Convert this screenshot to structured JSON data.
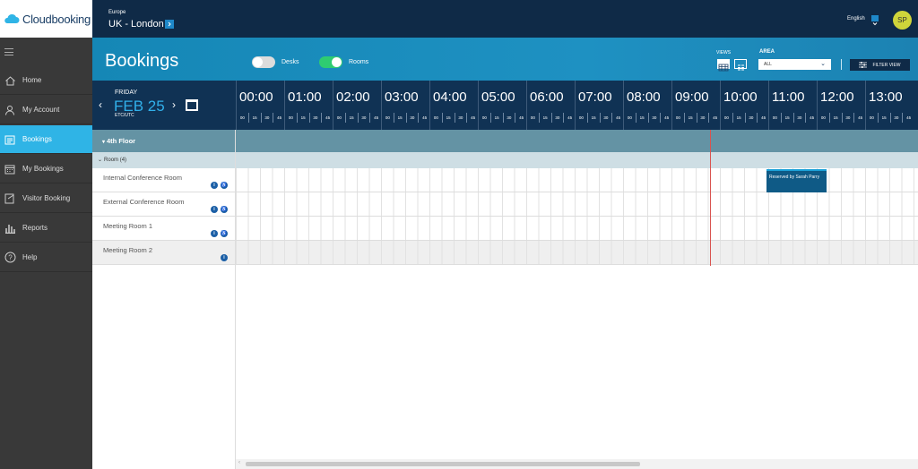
{
  "app": {
    "logo_text": "Cloudbooking"
  },
  "topbar": {
    "region": "Europe",
    "location": "UK - London",
    "language": "English",
    "avatar_initials": "SP"
  },
  "sidebar": {
    "items": [
      {
        "label": "Home",
        "icon": "home-icon"
      },
      {
        "label": "My Account",
        "icon": "user-icon"
      },
      {
        "label": "Bookings",
        "icon": "bookings-icon"
      },
      {
        "label": "My Bookings",
        "icon": "calendar-icon"
      },
      {
        "label": "Visitor Booking",
        "icon": "visitor-icon"
      },
      {
        "label": "Reports",
        "icon": "bar-chart-icon"
      },
      {
        "label": "Help",
        "icon": "help-icon"
      }
    ],
    "active": "Bookings"
  },
  "header": {
    "title": "Bookings",
    "toggles": {
      "desks_label": "Desks",
      "desks_on": false,
      "rooms_label": "Rooms",
      "rooms_on": true
    },
    "views_label": "VIEWS",
    "area_label": "AREA",
    "area_value": "ALL",
    "filter_label": "FILTER VIEW"
  },
  "date": {
    "weekday": "FRIDAY",
    "date": "FEB 25",
    "timezone": "ETC/UTC"
  },
  "timeline": {
    "hours": [
      "00:00",
      "01:00",
      "02:00",
      "03:00",
      "04:00",
      "05:00",
      "06:00",
      "07:00",
      "08:00",
      "09:00",
      "10:00",
      "11:00",
      "12:00",
      "13:00"
    ],
    "minutes": [
      "00",
      "15",
      "30",
      "45"
    ]
  },
  "floor": {
    "label": "4th Floor"
  },
  "group": {
    "label": "Room (4)"
  },
  "rooms": [
    {
      "name": "Internal Conference Room",
      "accessible": true
    },
    {
      "name": "External Conference Room",
      "accessible": true
    },
    {
      "name": "Meeting Room 1",
      "accessible": true
    },
    {
      "name": "Meeting Room 2",
      "accessible": false
    }
  ],
  "bookings": [
    {
      "room": "Internal Conference Room",
      "label": "Reserved by Sarah Parry",
      "start": "11:00",
      "end": "12:15"
    }
  ],
  "colors": {
    "accent": "#2fb4e6",
    "navy": "#0f2a47",
    "floor": "#6493a4",
    "booking": "#0f5a86",
    "now_line": "#d9534f"
  }
}
